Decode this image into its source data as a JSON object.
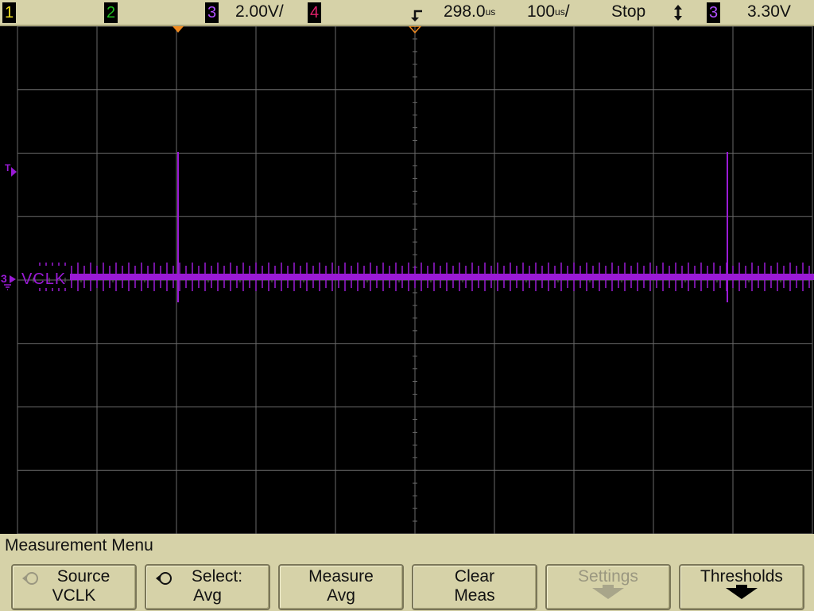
{
  "topbar": {
    "ch1_label": "1",
    "ch2_label": "2",
    "ch3_label": "3",
    "ch4_label": "4",
    "ch3_scale": "2.00V/",
    "trigger_delay": "298.0",
    "trigger_delay_unit": "us",
    "timebase": "100",
    "timebase_unit": "us",
    "timebase_suffix": "/",
    "run_state": "Stop",
    "trigger_slope_icon": "updown-arrow-icon",
    "trigger_source": "3",
    "trigger_level": "3.30V"
  },
  "screen": {
    "trace_label": "VCLK",
    "ch_marker": "3",
    "trigger_marker": "T",
    "trace_color": "#9a1ad6",
    "grid_color": "#6a6a6a"
  },
  "menu": {
    "title": "Measurement Menu",
    "softkeys": [
      {
        "line1": "Source",
        "line2": "VCLK",
        "icon": "rotate-knob-icon",
        "enabled": false
      },
      {
        "line1": "Select:",
        "line2": "Avg",
        "icon": "rotate-knob-icon",
        "enabled": true
      },
      {
        "line1": "Measure",
        "line2": "Avg",
        "enabled": true
      },
      {
        "line1": "Clear",
        "line2": "Meas",
        "enabled": true
      },
      {
        "line1": "Settings",
        "line2": "",
        "icon": "arrow-down-icon",
        "enabled": false
      },
      {
        "line1": "Thresholds",
        "line2": "",
        "icon": "arrow-down-icon",
        "enabled": true
      }
    ]
  },
  "colors": {
    "panel": "#d6d2a8",
    "ch1": "#f0e020",
    "ch2": "#20c020",
    "ch3": "#9a1ad6",
    "ch4": "#e0206a",
    "trigger_marker": "#f08a20"
  }
}
